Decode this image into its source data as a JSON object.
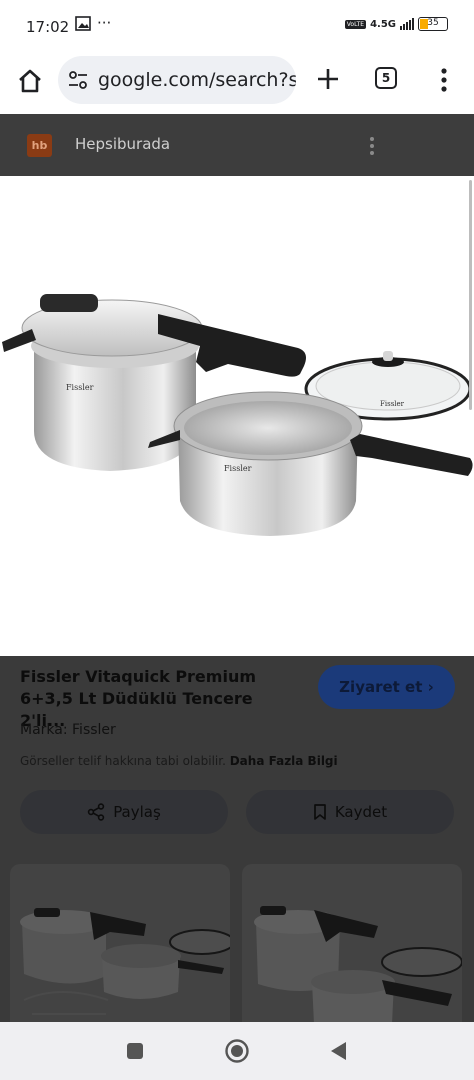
{
  "status_bar": {
    "time": "17:02",
    "notification_icons": [
      "image-notification",
      "more-notifications"
    ],
    "more": "···",
    "network": "4.5G",
    "volte": "VoLTE",
    "battery": "35"
  },
  "browser": {
    "url": "google.com/search?sca",
    "tab_count": "5"
  },
  "result": {
    "source_name": "Hepsiburada",
    "source_logo": "hb",
    "title": "Fissler Vitaquick Premium 6+3,5 Lt Düdüklü Tencere 2'li...",
    "visit_label": "Ziyaret et",
    "brand": "Marka: Fissler",
    "copyright_text": "Görseller telif hakkına tabi olabilir.",
    "more_info_link": "Daha Fazla Bilgi",
    "share_label": "Paylaş",
    "save_label": "Kaydet"
  },
  "colors": {
    "accent_button": "#1b3a7a",
    "scrim": "#3c3c3c"
  },
  "nav_bar": {
    "items": [
      "recents-square-icon",
      "home-circle-icon",
      "back-triangle-icon"
    ]
  }
}
